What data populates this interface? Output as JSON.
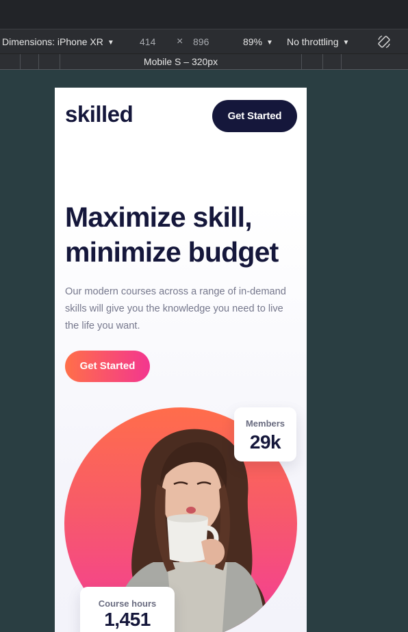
{
  "devtools": {
    "dimensions_label": "Dimensions: iPhone XR",
    "width_value": "414",
    "times_symbol": "×",
    "height_value": "896",
    "zoom": "89%",
    "throttling": "No throttling",
    "rotate_icon": "rotate-device-icon",
    "media_query_label": "Mobile S – 320px"
  },
  "site": {
    "logo": "skilled",
    "nav_button": "Get Started",
    "hero_title": "Maximize skill, minimize budget",
    "hero_text": "Our modern courses across a range of in-demand skills will give you the knowledge you need to live the life you want.",
    "cta_button": "Get Started",
    "stats": {
      "members_label": "Members",
      "members_value": "29k",
      "hours_label": "Course hours",
      "hours_value": "1,451"
    },
    "colors": {
      "navy": "#15173b",
      "gradient_start": "#ff6f49",
      "gradient_end": "#f3368f"
    }
  }
}
